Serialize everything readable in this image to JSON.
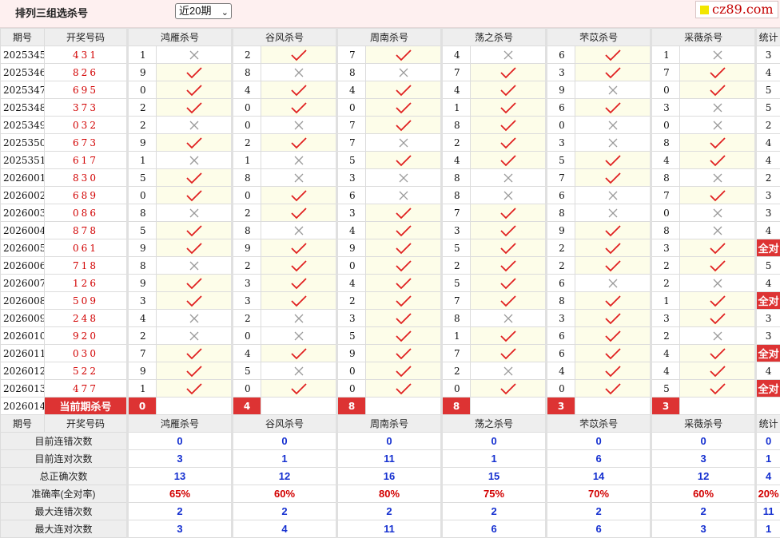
{
  "title": "排列三组选杀号",
  "period_select": "近20期",
  "logo": "cz89.com",
  "colors": {
    "accent_red": "#d33333",
    "check_red": "#e02020",
    "x_gray": "#9a9a9a",
    "value_blue": "#1530d0"
  },
  "headers": [
    "期号",
    "开奖号码",
    "鸿雁杀号",
    "谷风杀号",
    "周南杀号",
    "荡之杀号",
    "芣苡杀号",
    "采薇杀号",
    "统计"
  ],
  "rows": [
    {
      "issue": "2025345",
      "code": "431",
      "kills": [
        1,
        2,
        7,
        4,
        6,
        1
      ],
      "marks": [
        "x",
        "c",
        "c",
        "x",
        "c",
        "x"
      ],
      "stat": "3"
    },
    {
      "issue": "2025346",
      "code": "826",
      "kills": [
        9,
        8,
        8,
        7,
        3,
        7
      ],
      "marks": [
        "c",
        "x",
        "x",
        "c",
        "c",
        "c"
      ],
      "stat": "4"
    },
    {
      "issue": "2025347",
      "code": "695",
      "kills": [
        0,
        4,
        4,
        4,
        9,
        0
      ],
      "marks": [
        "c",
        "c",
        "c",
        "c",
        "x",
        "c"
      ],
      "stat": "5"
    },
    {
      "issue": "2025348",
      "code": "373",
      "kills": [
        2,
        0,
        0,
        1,
        6,
        3
      ],
      "marks": [
        "c",
        "c",
        "c",
        "c",
        "c",
        "x"
      ],
      "stat": "5"
    },
    {
      "issue": "2025349",
      "code": "032",
      "kills": [
        2,
        0,
        7,
        8,
        0,
        0
      ],
      "marks": [
        "x",
        "x",
        "c",
        "c",
        "x",
        "x"
      ],
      "stat": "2"
    },
    {
      "issue": "2025350",
      "code": "673",
      "kills": [
        9,
        2,
        7,
        2,
        3,
        8
      ],
      "marks": [
        "c",
        "c",
        "x",
        "c",
        "x",
        "c"
      ],
      "stat": "4"
    },
    {
      "issue": "2025351",
      "code": "617",
      "kills": [
        1,
        1,
        5,
        4,
        5,
        4
      ],
      "marks": [
        "x",
        "x",
        "c",
        "c",
        "c",
        "c"
      ],
      "stat": "4"
    },
    {
      "issue": "2026001",
      "code": "830",
      "kills": [
        5,
        8,
        3,
        8,
        7,
        8
      ],
      "marks": [
        "c",
        "x",
        "x",
        "x",
        "c",
        "x"
      ],
      "stat": "2"
    },
    {
      "issue": "2026002",
      "code": "689",
      "kills": [
        0,
        0,
        6,
        8,
        6,
        7
      ],
      "marks": [
        "c",
        "c",
        "x",
        "x",
        "x",
        "c"
      ],
      "stat": "3"
    },
    {
      "issue": "2026003",
      "code": "086",
      "kills": [
        8,
        2,
        3,
        7,
        8,
        0
      ],
      "marks": [
        "x",
        "c",
        "c",
        "c",
        "x",
        "x"
      ],
      "stat": "3"
    },
    {
      "issue": "2026004",
      "code": "878",
      "kills": [
        5,
        8,
        4,
        3,
        9,
        8
      ],
      "marks": [
        "c",
        "x",
        "c",
        "c",
        "c",
        "x"
      ],
      "stat": "4"
    },
    {
      "issue": "2026005",
      "code": "061",
      "kills": [
        9,
        9,
        9,
        5,
        2,
        3
      ],
      "marks": [
        "c",
        "c",
        "c",
        "c",
        "c",
        "c"
      ],
      "stat": "全对"
    },
    {
      "issue": "2026006",
      "code": "718",
      "kills": [
        8,
        2,
        0,
        2,
        2,
        2
      ],
      "marks": [
        "x",
        "c",
        "c",
        "c",
        "c",
        "c"
      ],
      "stat": "5"
    },
    {
      "issue": "2026007",
      "code": "126",
      "kills": [
        9,
        3,
        4,
        5,
        6,
        2
      ],
      "marks": [
        "c",
        "c",
        "c",
        "c",
        "x",
        "x"
      ],
      "stat": "4"
    },
    {
      "issue": "2026008",
      "code": "509",
      "kills": [
        3,
        3,
        2,
        7,
        8,
        1
      ],
      "marks": [
        "c",
        "c",
        "c",
        "c",
        "c",
        "c"
      ],
      "stat": "全对"
    },
    {
      "issue": "2026009",
      "code": "248",
      "kills": [
        4,
        2,
        3,
        8,
        3,
        3
      ],
      "marks": [
        "x",
        "x",
        "c",
        "x",
        "c",
        "c"
      ],
      "stat": "3"
    },
    {
      "issue": "2026010",
      "code": "920",
      "kills": [
        2,
        0,
        5,
        1,
        6,
        2
      ],
      "marks": [
        "x",
        "x",
        "c",
        "c",
        "c",
        "x"
      ],
      "stat": "3"
    },
    {
      "issue": "2026011",
      "code": "030",
      "kills": [
        7,
        4,
        9,
        7,
        6,
        4
      ],
      "marks": [
        "c",
        "c",
        "c",
        "c",
        "c",
        "c"
      ],
      "stat": "全对"
    },
    {
      "issue": "2026012",
      "code": "522",
      "kills": [
        9,
        5,
        0,
        2,
        4,
        4
      ],
      "marks": [
        "c",
        "x",
        "c",
        "x",
        "c",
        "c"
      ],
      "stat": "4"
    },
    {
      "issue": "2026013",
      "code": "477",
      "kills": [
        1,
        0,
        0,
        0,
        0,
        5
      ],
      "marks": [
        "c",
        "c",
        "c",
        "c",
        "c",
        "c"
      ],
      "stat": "全对"
    }
  ],
  "current": {
    "issue": "2026014",
    "label": "当前期杀号",
    "kills": [
      0,
      4,
      8,
      8,
      3,
      3
    ]
  },
  "summary": {
    "headers": [
      "期号",
      "开奖号码",
      "鸿雁杀号",
      "谷风杀号",
      "周南杀号",
      "荡之杀号",
      "芣苡杀号",
      "采薇杀号",
      "统计"
    ],
    "rows": [
      {
        "label": "目前连错次数",
        "values": [
          "0",
          "0",
          "0",
          "0",
          "0",
          "0",
          "0"
        ],
        "red": false
      },
      {
        "label": "目前连对次数",
        "values": [
          "3",
          "1",
          "11",
          "1",
          "6",
          "3",
          "1"
        ],
        "red": false
      },
      {
        "label": "总正确次数",
        "values": [
          "13",
          "12",
          "16",
          "15",
          "14",
          "12",
          "4"
        ],
        "red": false
      },
      {
        "label": "准确率(全对率)",
        "values": [
          "65%",
          "60%",
          "80%",
          "75%",
          "70%",
          "60%",
          "20%"
        ],
        "red": true
      },
      {
        "label": "最大连错次数",
        "values": [
          "2",
          "2",
          "2",
          "2",
          "2",
          "2",
          "11"
        ],
        "red": false
      },
      {
        "label": "最大连对次数",
        "values": [
          "3",
          "4",
          "11",
          "6",
          "6",
          "3",
          "1"
        ],
        "red": false
      }
    ]
  }
}
